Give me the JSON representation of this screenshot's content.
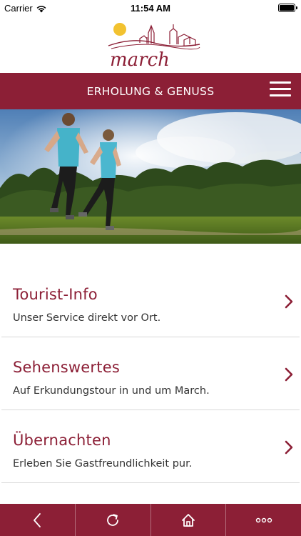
{
  "status_bar": {
    "carrier": "Carrier",
    "time": "11:54 AM"
  },
  "logo": {
    "text": "march"
  },
  "header": {
    "title": "ERHOLUNG & GENUSS"
  },
  "items": [
    {
      "title": "Tourist-Info",
      "subtitle": "Unser Service direkt vor Ort."
    },
    {
      "title": "Sehenswertes",
      "subtitle": "Auf Erkundungstour in und um March."
    },
    {
      "title": "Übernachten",
      "subtitle": "Erleben Sie Gastfreundlichkeit pur."
    }
  ],
  "colors": {
    "brand": "#8c1f36",
    "sun": "#f2c230",
    "text": "#333333"
  },
  "bottom_bar": {
    "icons": [
      "back-icon",
      "reload-icon",
      "home-icon",
      "more-icon"
    ]
  }
}
